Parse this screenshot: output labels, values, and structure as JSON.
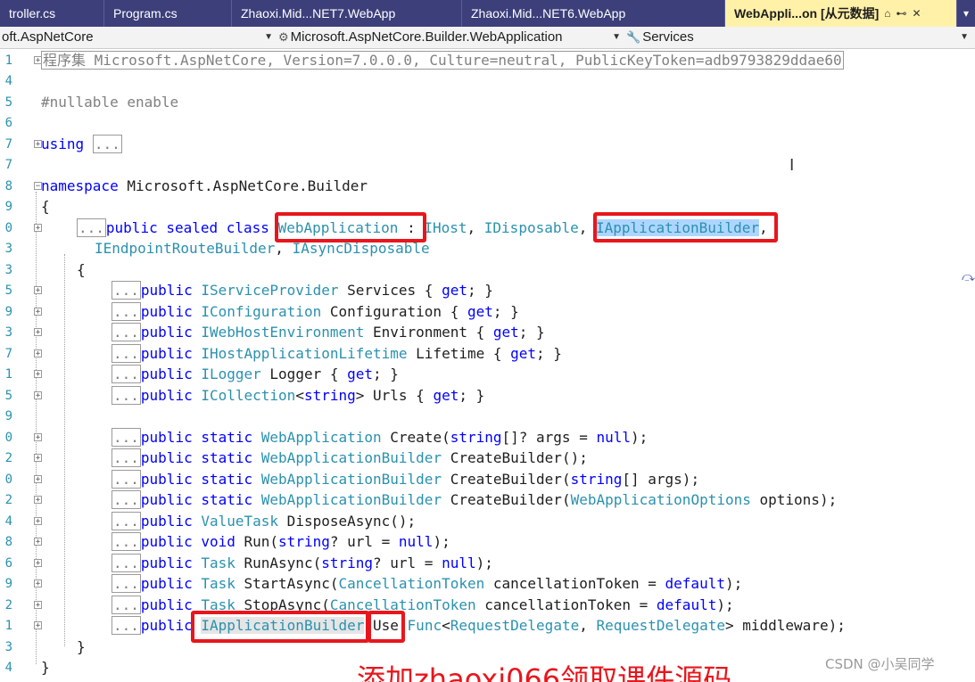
{
  "tabs": [
    {
      "label": "troller.cs"
    },
    {
      "label": "Program.cs"
    },
    {
      "label": "Zhaoxi.Mid...NET7.WebApp"
    },
    {
      "label": "Zhaoxi.Mid...NET6.WebApp"
    },
    {
      "label": "WebAppli...on [从元数据]"
    }
  ],
  "nav": {
    "project": "oft.AspNetCore",
    "type": "Microsoft.AspNetCore.Builder.WebApplication",
    "member": "Services"
  },
  "icons": {
    "tab_lock": "lock-icon",
    "tab_pin": "pin-icon",
    "tab_close": "close-icon",
    "tab_overflow": "chevron-down-icon",
    "nav_class": "class-icon",
    "nav_wrench": "wrench-icon"
  },
  "colors": {
    "tab_bar": "#3c3f7a",
    "active_tab": "#fff1a8",
    "keyword": "#0000ff",
    "type": "#2b91af",
    "highlight_box": "#e8161c"
  },
  "lines": [
    {
      "num": "1"
    },
    {
      "num": "4"
    },
    {
      "num": "5"
    },
    {
      "num": "6"
    },
    {
      "num": "7"
    },
    {
      "num": "7"
    },
    {
      "num": "8"
    },
    {
      "num": "9"
    },
    {
      "num": "0"
    },
    {
      "num": "3"
    },
    {
      "num": "3"
    },
    {
      "num": "5"
    },
    {
      "num": "9"
    },
    {
      "num": "3"
    },
    {
      "num": "7"
    },
    {
      "num": "1"
    },
    {
      "num": "5"
    },
    {
      "num": "9"
    },
    {
      "num": "0"
    },
    {
      "num": "2"
    },
    {
      "num": "0"
    },
    {
      "num": "2"
    },
    {
      "num": "4"
    },
    {
      "num": "8"
    },
    {
      "num": "6"
    },
    {
      "num": "9"
    },
    {
      "num": "2"
    },
    {
      "num": "1"
    },
    {
      "num": "3"
    },
    {
      "num": "4"
    }
  ],
  "watermark": "CSDN @小吴同学",
  "banner": "添加zhaoxi066领取课件源码"
}
